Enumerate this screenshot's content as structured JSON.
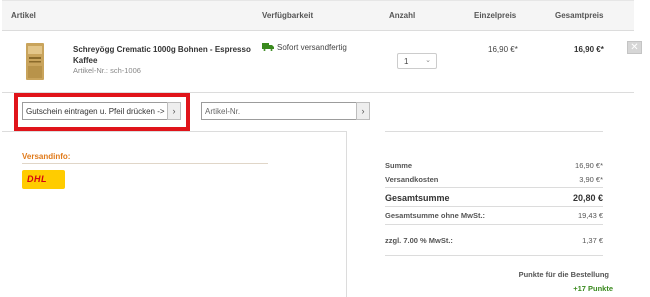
{
  "header": {
    "article": "Artikel",
    "availability": "Verfügbarkeit",
    "quantity": "Anzahl",
    "unit_price": "Einzelpreis",
    "total_price": "Gesamtpreis"
  },
  "item": {
    "name": "Schreyögg Crematic 1000g Bohnen - Espresso Kaffee",
    "number": "Artikel-Nr.: sch-1006",
    "availability": "Sofort versandfertig",
    "quantity": "1",
    "unit_price": "16,90 €*",
    "total_price": "16,90 €*",
    "remove_label": "✕"
  },
  "voucher": {
    "placeholder": "Gutschein eintragen u. Pfeil drücken ->",
    "button": "›"
  },
  "article_add": {
    "placeholder": "Artikel-Nr.",
    "button": "›"
  },
  "shipping": {
    "title": "Versandinfo:",
    "carrier": "DHL"
  },
  "summary": {
    "sum_label": "Summe",
    "sum_value": "16,90 €*",
    "shipping_label": "Versandkosten",
    "shipping_value": "3,90 €*",
    "grand_label": "Gesamtsumme",
    "grand_value": "20,80 €",
    "net_label": "Gesamtsumme ohne MwSt.:",
    "net_value": "19,43 €",
    "tax_label": "zzgl. 7.00 % MwSt.:",
    "tax_value": "1,37 €",
    "points_label": "Punkte für die Bestellung",
    "points_value": "+17 Punkte"
  },
  "colors": {
    "highlight": "#e0141a",
    "shipping_title": "#e07a1a",
    "points": "#3a8a1e",
    "dhl_yellow": "#ffcc00",
    "dhl_red": "#d40511"
  }
}
